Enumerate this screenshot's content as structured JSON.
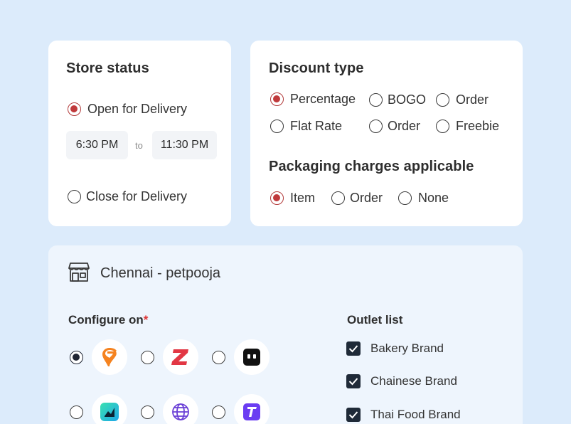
{
  "store_status": {
    "title": "Store status",
    "open_label": "Open for Delivery",
    "from_time": "6:30 PM",
    "to_word": "to",
    "to_time": "11:30 PM",
    "close_label": "Close for Delivery"
  },
  "discount": {
    "title": "Discount type",
    "options": [
      "Percentage",
      "BOGO",
      "Order",
      "Flat Rate",
      "Order",
      "Freebie"
    ],
    "selected": "Percentage"
  },
  "packaging": {
    "title": "Packaging charges applicable",
    "options": [
      "Item",
      "Order",
      "None"
    ],
    "selected": "Item"
  },
  "outlet": {
    "store_name": "Chennai - petpooja",
    "configure_label": "Configure on",
    "required_mark": "*",
    "platforms": [
      "swiggy-icon",
      "zomato-icon",
      "robot-app-icon",
      "chart-app-icon",
      "globe-icon",
      "t-app-icon"
    ],
    "outlet_list_label": "Outlet list",
    "brands": [
      "Bakery Brand",
      "Chainese Brand",
      "Thai Food Brand"
    ]
  },
  "colors": {
    "background": "#dcebfb",
    "accent_red": "#c0393b",
    "checkbox_dark": "#1f2a38"
  }
}
